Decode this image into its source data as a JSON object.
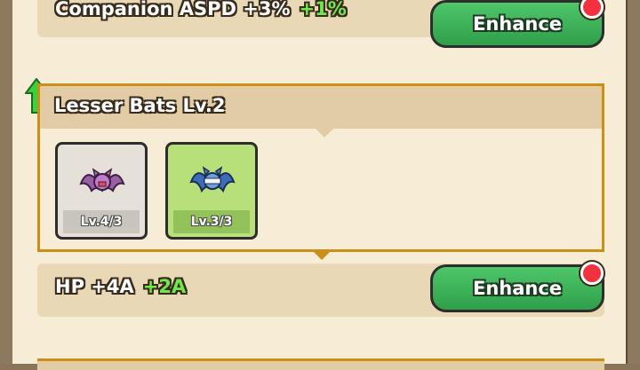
{
  "rows": [
    {
      "stat": "Companion ASPD +3%",
      "bonus": "+1%",
      "button": "Enhance"
    },
    {
      "stat": "HP +4A",
      "bonus": "+2A",
      "button": "Enhance"
    }
  ],
  "set": {
    "title": "Lesser Bats Lv.2",
    "cards": [
      {
        "name": "bat-pink",
        "level": "Lv.4/3"
      },
      {
        "name": "bat-blue",
        "level": "Lv.3/3"
      }
    ]
  },
  "colors": {
    "bonus_green": "#6ee84a",
    "button_green": "#3db45a",
    "badge_red": "#f3303e",
    "frame_gold": "#c98f16"
  }
}
